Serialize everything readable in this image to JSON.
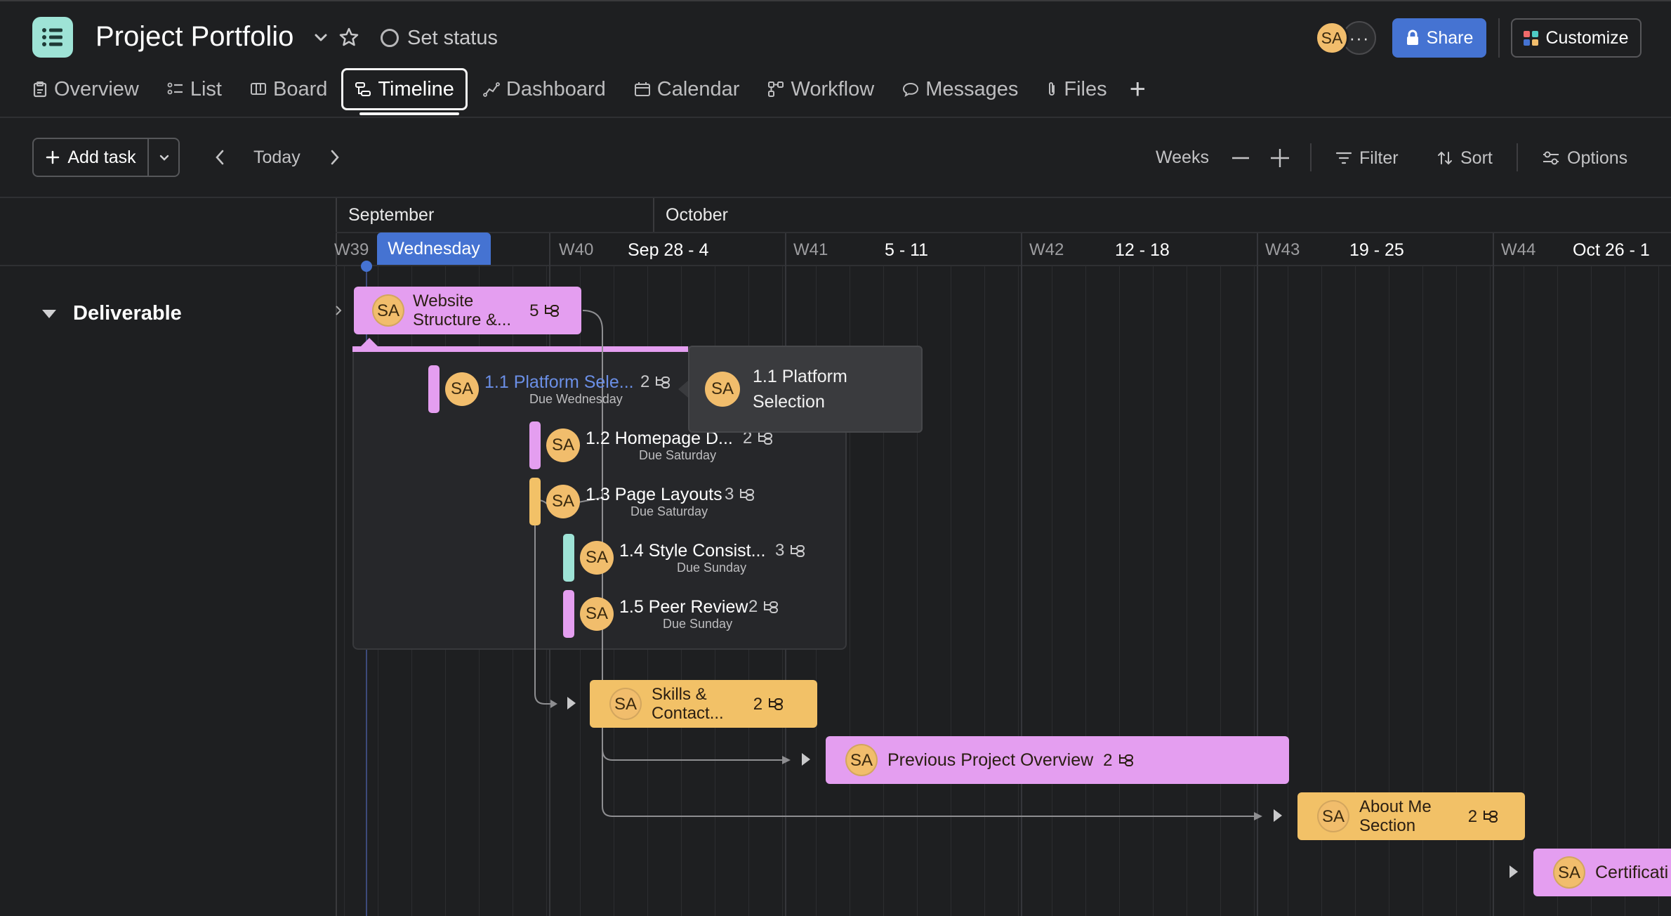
{
  "header": {
    "title": "Project Portfolio",
    "set_status": "Set status",
    "avatar_initials": "SA",
    "share_label": "Share",
    "customize_label": "Customize"
  },
  "tabs": [
    {
      "label": "Overview",
      "icon": "clipboard-icon"
    },
    {
      "label": "List",
      "icon": "list-icon"
    },
    {
      "label": "Board",
      "icon": "board-icon"
    },
    {
      "label": "Timeline",
      "icon": "timeline-icon",
      "active": true
    },
    {
      "label": "Dashboard",
      "icon": "dashboard-icon"
    },
    {
      "label": "Calendar",
      "icon": "calendar-icon"
    },
    {
      "label": "Workflow",
      "icon": "workflow-icon"
    },
    {
      "label": "Messages",
      "icon": "message-icon"
    },
    {
      "label": "Files",
      "icon": "paperclip-icon"
    }
  ],
  "toolbar": {
    "add_task": "Add task",
    "today": "Today",
    "weeks": "Weeks",
    "filter": "Filter",
    "sort": "Sort",
    "options": "Options"
  },
  "timeline": {
    "months": [
      "September",
      "October"
    ],
    "today_label": "Wednesday",
    "weeks": [
      {
        "num": "W39",
        "range": ""
      },
      {
        "num": "W40",
        "range": "Sep 28 - 4"
      },
      {
        "num": "W41",
        "range": "5 - 11"
      },
      {
        "num": "W42",
        "range": "12 - 18"
      },
      {
        "num": "W43",
        "range": "19 - 25"
      },
      {
        "num": "W44",
        "range": "Oct 26 - 1"
      }
    ]
  },
  "section": {
    "name": "Deliverable"
  },
  "tasks": {
    "parent": {
      "title": "Website Structure &...",
      "title_line1": "Website",
      "title_line2": "Structure &...",
      "count": "5",
      "assignee": "SA",
      "color": "#e49ef0"
    },
    "subtasks": [
      {
        "title": "1.1 Platform Sele...",
        "due": "Due Wednesday",
        "count": "2",
        "assignee": "SA",
        "color": "#e49ef0"
      },
      {
        "title": "1.2 Homepage D...",
        "due": "Due Saturday",
        "count": "2",
        "assignee": "SA",
        "color": "#e49ef0"
      },
      {
        "title": "1.3 Page Layouts",
        "due": "Due Saturday",
        "count": "3",
        "assignee": "SA",
        "color": "#f2c167"
      },
      {
        "title": "1.4 Style Consist...",
        "due": "Due Sunday",
        "count": "3",
        "assignee": "SA",
        "color": "#9ee3d6"
      },
      {
        "title": "1.5 Peer Review",
        "due": "Due Sunday",
        "count": "2",
        "assignee": "SA",
        "color": "#e49ef0"
      }
    ],
    "tooltip": {
      "line1": "1.1 Platform",
      "line2": "Selection",
      "assignee": "SA"
    },
    "skills": {
      "line1": "Skills &",
      "line2": "Contact...",
      "count": "2",
      "assignee": "SA",
      "color": "#f2c167"
    },
    "previous": {
      "title": "Previous Project Overview",
      "count": "2",
      "assignee": "SA",
      "color": "#e49ef0"
    },
    "about": {
      "line1": "About Me",
      "line2": "Section",
      "count": "2",
      "assignee": "SA",
      "color": "#f2c167"
    },
    "cert": {
      "title": "Certificati",
      "assignee": "SA",
      "color": "#e49ef0"
    }
  },
  "colors": {
    "accent": "#4573d2",
    "background": "#1e1f21",
    "app_icon": "#9ee3d6",
    "avatar": "#f1bd6c"
  }
}
